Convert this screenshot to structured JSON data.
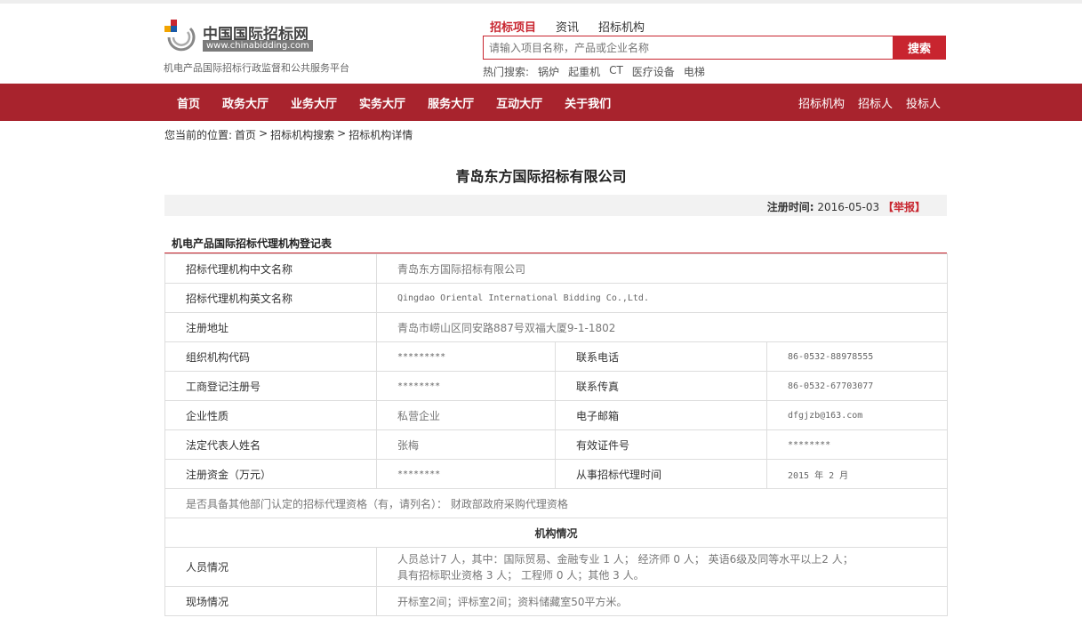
{
  "header": {
    "logo_cn": "中国国际招标网",
    "logo_url": "www.chinabidding.com",
    "slogan": "机电产品国际招标行政监督和公共服务平台",
    "search_tabs": [
      "招标项目",
      "资讯",
      "招标机构"
    ],
    "search_placeholder": "请输入项目名称，产品或企业名称",
    "search_button": "搜索",
    "hot_label": "热门搜索:",
    "hot_items": [
      "锅炉",
      "起重机",
      "CT",
      "医疗设备",
      "电梯"
    ]
  },
  "nav": {
    "left": [
      "首页",
      "政务大厅",
      "业务大厅",
      "实务大厅",
      "服务大厅",
      "互动大厅",
      "关于我们"
    ],
    "right": [
      "招标机构",
      "招标人",
      "投标人"
    ]
  },
  "breadcrumb": {
    "prefix": "您当前的位置:",
    "items": [
      "首页",
      ">",
      "招标机构搜索",
      ">",
      "招标机构详情"
    ]
  },
  "page": {
    "title": "青岛东方国际招标有限公司",
    "reg_label": "注册时间:",
    "reg_date": "2016-05-03",
    "report": "【举报】",
    "section_title": "机电产品国际招标代理机构登记表"
  },
  "table": {
    "cn_name_label": "招标代理机构中文名称",
    "cn_name": "青岛东方国际招标有限公司",
    "en_name_label": "招标代理机构英文名称",
    "en_name": "Qingdao Oriental International Bidding Co.,Ltd.",
    "address_label": "注册地址",
    "address": "青岛市崂山区同安路887号双福大厦9-1-1802",
    "org_code_label": "组织机构代码",
    "org_code": "*********",
    "phone_label": "联系电话",
    "phone": "86-0532-88978555",
    "biz_reg_label": "工商登记注册号",
    "biz_reg": "********",
    "fax_label": "联系传真",
    "fax": "86-0532-67703077",
    "nature_label": "企业性质",
    "nature": "私营企业",
    "email_label": "电子邮箱",
    "email": "dfgjzb@163.com",
    "legal_label": "法定代表人姓名",
    "legal": "张梅",
    "id_label": "有效证件号",
    "id": "********",
    "capital_label": "注册资金（万元）",
    "capital": "********",
    "since_label": "从事招标代理时间",
    "since": "2015 年 2 月",
    "other_qual": "是否具备其他部门认定的招标代理资格（有，请列名）： 财政部政府采购代理资格",
    "org_header": "机构情况",
    "staff_label": "人员情况",
    "staff_line1": "人员总计7 人，其中：国际贸易、金融专业 1 人； 经济师 0 人； 英语6级及同等水平以上2 人；",
    "staff_line2": "具有招标职业资格 3 人； 工程师 0 人；其他 3 人。",
    "site_label": "现场情况",
    "site": "开标室2间；评标室2间；资料储藏室50平方米。"
  },
  "colors": {
    "accent": "#c8252f",
    "nav_bg": "#a8232d"
  }
}
